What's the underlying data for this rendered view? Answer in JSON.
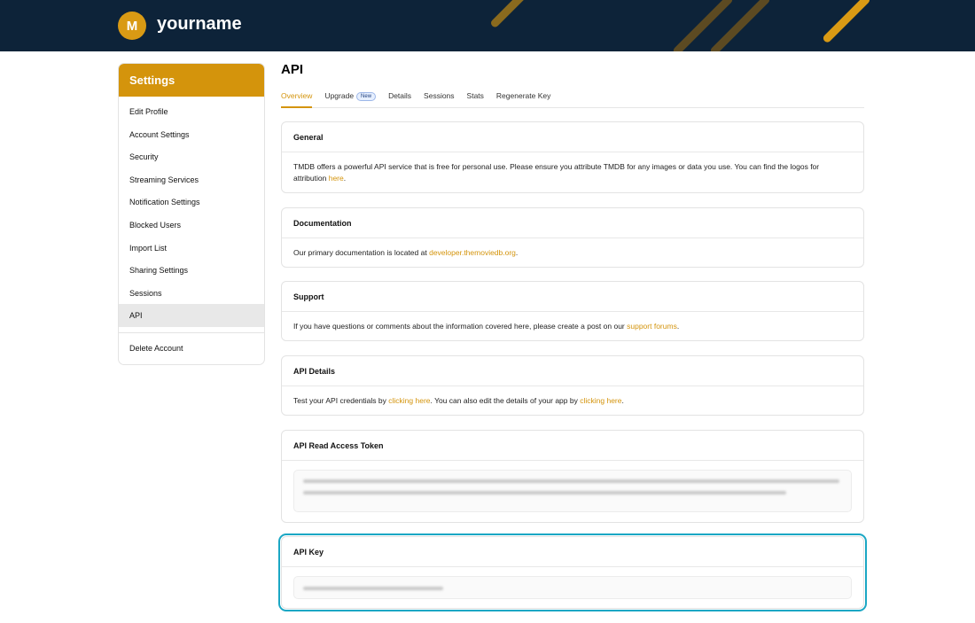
{
  "header": {
    "avatar_initial": "M",
    "username": "yourname",
    "background_color": "#0d2339",
    "accent_color": "#d99a14"
  },
  "sidebar": {
    "title": "Settings",
    "items": [
      {
        "label": "Edit Profile"
      },
      {
        "label": "Account Settings"
      },
      {
        "label": "Security"
      },
      {
        "label": "Streaming Services"
      },
      {
        "label": "Notification Settings"
      },
      {
        "label": "Blocked Users"
      },
      {
        "label": "Import List"
      },
      {
        "label": "Sharing Settings"
      },
      {
        "label": "Sessions"
      },
      {
        "label": "API",
        "active": true
      }
    ],
    "footer_item": {
      "label": "Delete Account"
    }
  },
  "main": {
    "title": "API",
    "tabs": [
      {
        "label": "Overview",
        "active": true
      },
      {
        "label": "Upgrade",
        "badge": "New"
      },
      {
        "label": "Details"
      },
      {
        "label": "Sessions"
      },
      {
        "label": "Stats"
      },
      {
        "label": "Regenerate Key"
      }
    ],
    "cards": {
      "general": {
        "title": "General",
        "text": "TMDB offers a powerful API service that is free for personal use. Please ensure you attribute TMDB for any images or data you use. You can find the logos for attribution",
        "link": "here",
        "suffix": "."
      },
      "documentation": {
        "title": "Documentation",
        "text": "Our primary documentation is located at",
        "link": "developer.themoviedb.org",
        "suffix": "."
      },
      "support": {
        "title": "Support",
        "text": "If you have questions or comments about the information covered here, please create a post on our",
        "link": "support forums",
        "suffix": "."
      },
      "api_details": {
        "title": "API Details",
        "text1": "Test your API credentials by",
        "link1": "clicking here",
        "text2": ". You can also edit the details of your app by",
        "link2": "clicking here",
        "suffix": "."
      },
      "read_access_token": {
        "title": "API Read Access Token"
      },
      "api_key": {
        "title": "API Key"
      }
    }
  }
}
